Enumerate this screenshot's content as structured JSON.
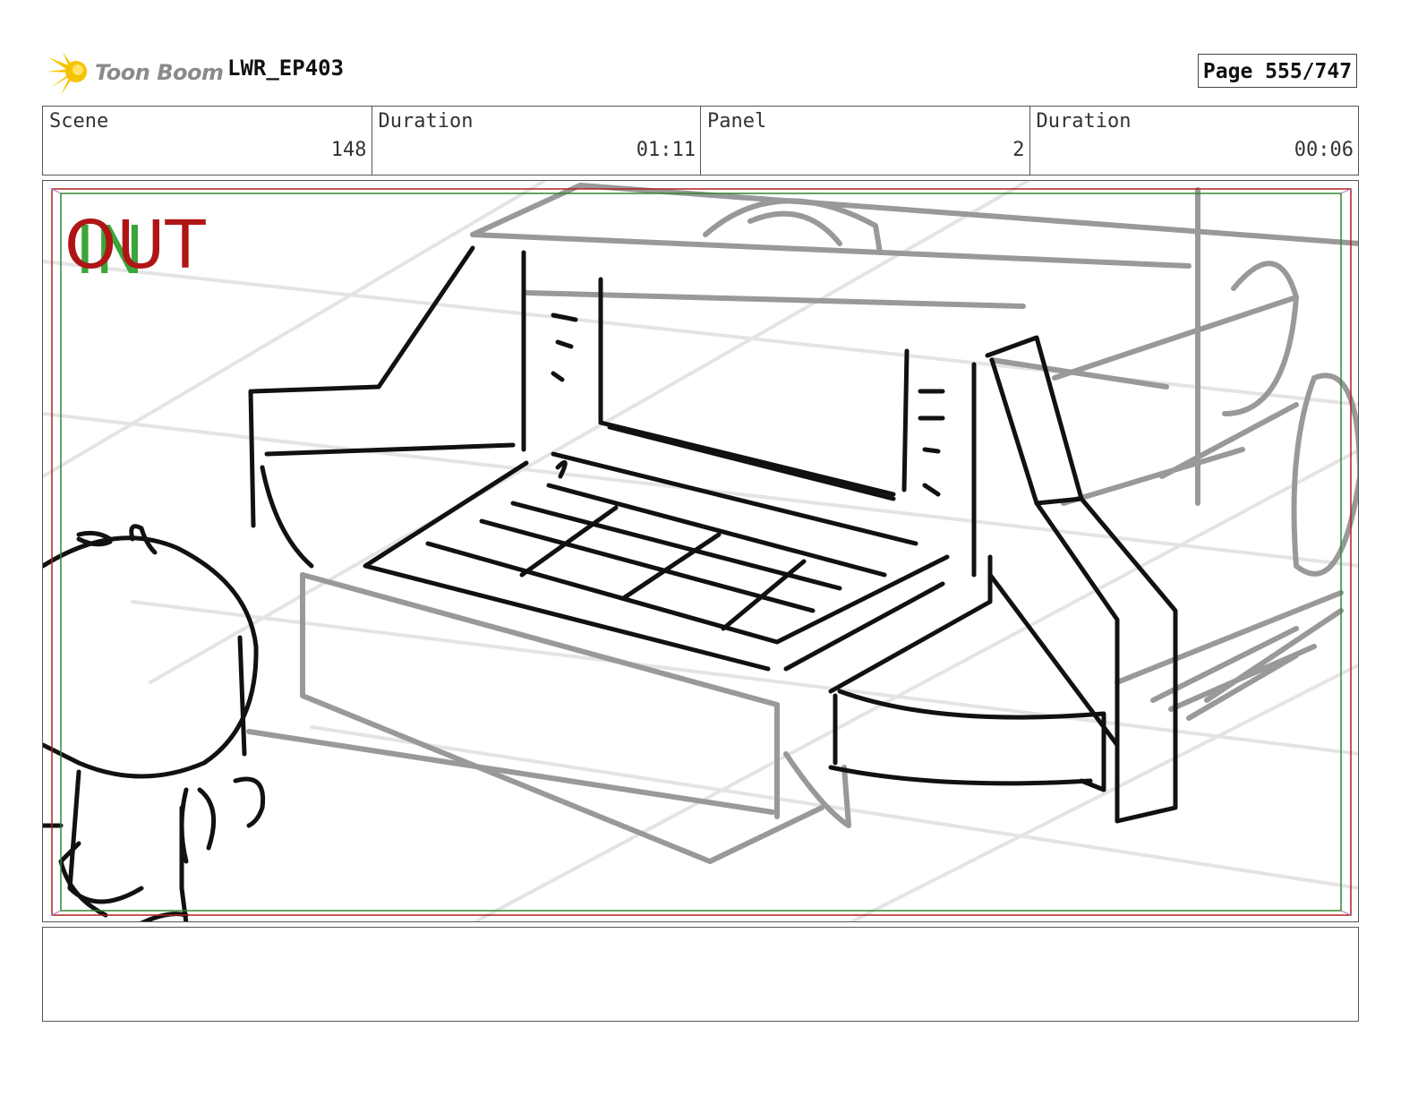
{
  "header": {
    "logo_text": "Toon Boom",
    "project": "LWR_EP403",
    "page": "Page 555/747"
  },
  "info": {
    "scene_label": "Scene",
    "scene_value": "148",
    "scene_duration_label": "Duration",
    "scene_duration_value": "01:11",
    "panel_label": "Panel",
    "panel_value": "2",
    "panel_duration_label": "Duration",
    "panel_duration_value": "00:06"
  },
  "panel": {
    "in_mark": "IN",
    "out_mark": "OUT",
    "colors": {
      "in": "#3aa53a",
      "out": "#b01515",
      "safe_green": "#2e8b2e",
      "safe_red": "#b02020"
    }
  },
  "notes": {
    "text": ""
  }
}
